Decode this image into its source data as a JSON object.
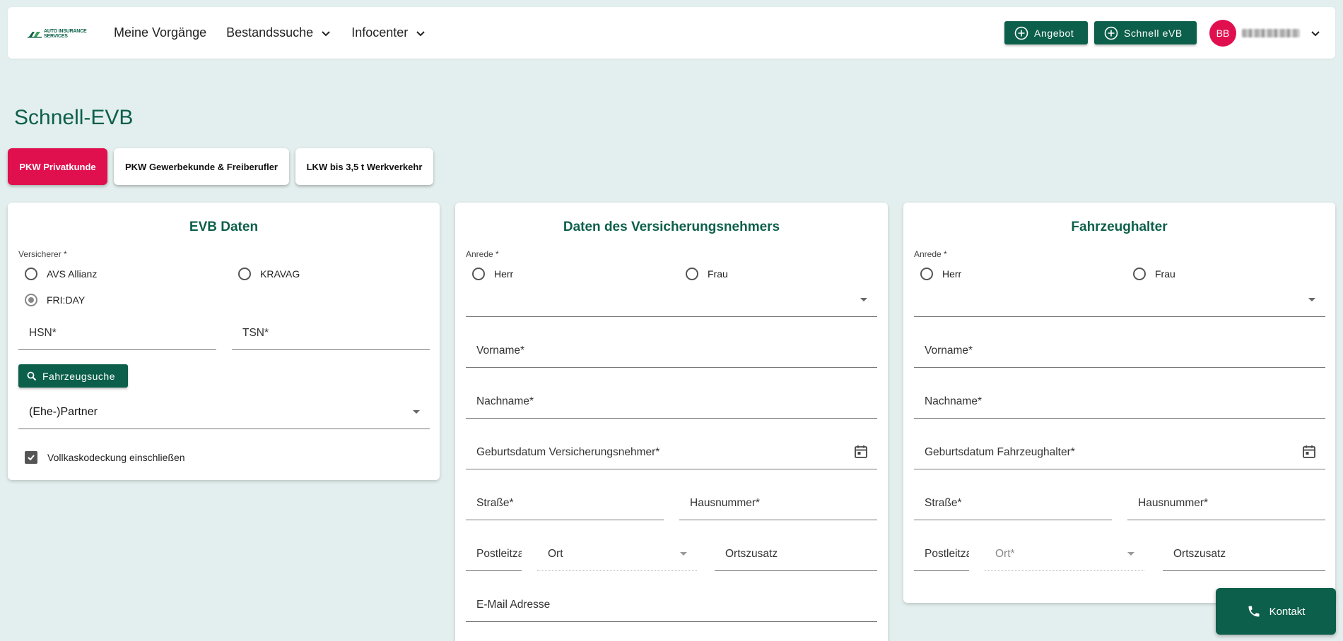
{
  "header": {
    "logo_line1": "AUTO INSURANCE",
    "logo_line2": "SERVICES",
    "nav": [
      {
        "label": "Meine Vorgänge",
        "has_dropdown": false
      },
      {
        "label": "Bestandssuche",
        "has_dropdown": true
      },
      {
        "label": "Infocenter",
        "has_dropdown": true
      }
    ],
    "btn_angebot": "Angebot",
    "btn_schnell": "Schnell eVB",
    "user_initials": "BB"
  },
  "page_title": "Schnell-EVB",
  "tabs": [
    {
      "label": "PKW Privatkunde",
      "active": true
    },
    {
      "label": "PKW Gewerbekunde & Freiberufler",
      "active": false
    },
    {
      "label": "LKW bis 3,5 t Werkverkehr",
      "active": false
    }
  ],
  "evb": {
    "title": "EVB Daten",
    "versicherer_label": "Versicherer *",
    "options": [
      "AVS Allianz",
      "KRAVAG",
      "FRI:DAY"
    ],
    "selected": "FRI:DAY",
    "hsn": "HSN*",
    "tsn": "TSN*",
    "search_btn": "Fahrzeugsuche",
    "relation_value": "(Ehe-)Partner",
    "checkbox_label": "Vollkaskodeckung einschließen",
    "checkbox_checked": true
  },
  "vn": {
    "title": "Daten des Versicherungsnehmers",
    "anrede_label": "Anrede *",
    "herr": "Herr",
    "frau": "Frau",
    "vorname": "Vorname*",
    "nachname": "Nachname*",
    "geburtsdatum": "Geburtsdatum Versicherungsnehmer*",
    "strasse": "Straße*",
    "hausnummer": "Hausnummer*",
    "plz": "Postleitzahl*",
    "ort": "Ort",
    "ortszusatz": "Ortszusatz",
    "email": "E-Mail Adresse"
  },
  "fh": {
    "title": "Fahrzeughalter",
    "anrede_label": "Anrede *",
    "herr": "Herr",
    "frau": "Frau",
    "vorname": "Vorname*",
    "nachname": "Nachname*",
    "geburtsdatum": "Geburtsdatum Fahrzeughalter*",
    "strasse": "Straße*",
    "hausnummer": "Hausnummer*",
    "plz": "Postleitzahl*",
    "ort": "Ort*",
    "ortszusatz": "Ortszusatz"
  },
  "kontakt": "Kontakt",
  "colors": {
    "primary": "#0c5f4a",
    "accent": "#e0104f",
    "background": "#e3efee"
  }
}
